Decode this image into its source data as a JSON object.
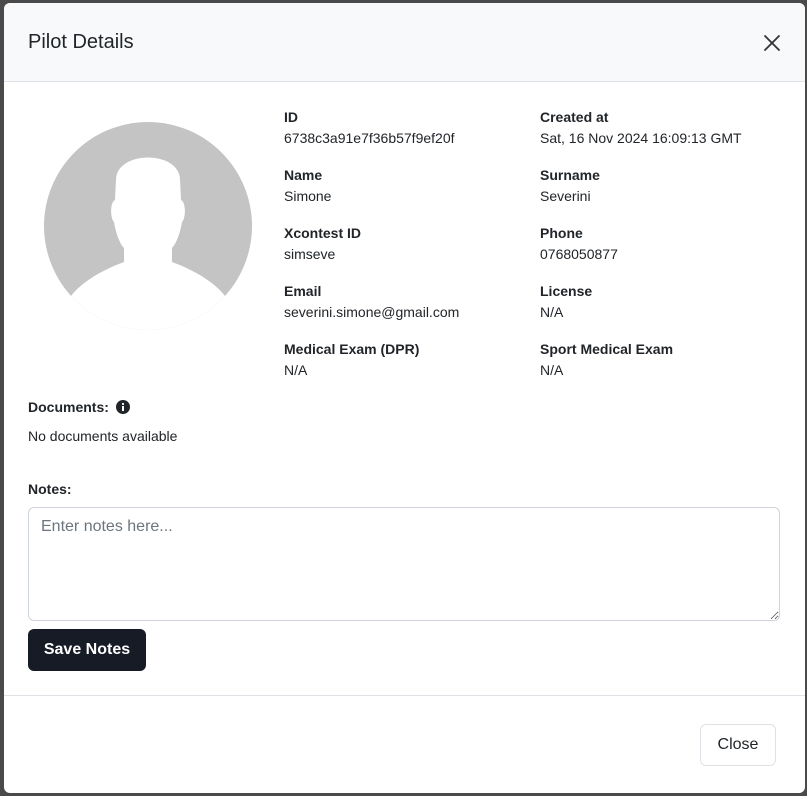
{
  "modal": {
    "title": "Pilot Details",
    "close_label": "Close"
  },
  "pilot": {
    "fields": [
      {
        "label": "ID",
        "value": "6738c3a91e7f36b57f9ef20f"
      },
      {
        "label": "Created at",
        "value": "Sat, 16 Nov 2024 16:09:13 GMT"
      },
      {
        "label": "Name",
        "value": "Simone"
      },
      {
        "label": "Surname",
        "value": "Severini"
      },
      {
        "label": "Xcontest ID",
        "value": "simseve"
      },
      {
        "label": "Phone",
        "value": "0768050877"
      },
      {
        "label": "Email",
        "value": "severini.simone@gmail.com"
      },
      {
        "label": "License",
        "value": "N/A"
      },
      {
        "label": "Medical Exam (DPR)",
        "value": "N/A"
      },
      {
        "label": "Sport Medical Exam",
        "value": "N/A"
      }
    ]
  },
  "documents": {
    "label": "Documents:",
    "empty_text": "No documents available"
  },
  "notes": {
    "label": "Notes:",
    "placeholder": "Enter notes here...",
    "value": "",
    "save_label": "Save Notes"
  },
  "colors": {
    "primary_button": "#161b26",
    "header_bg": "#f8f9fa",
    "avatar": "#c4c4c4"
  }
}
